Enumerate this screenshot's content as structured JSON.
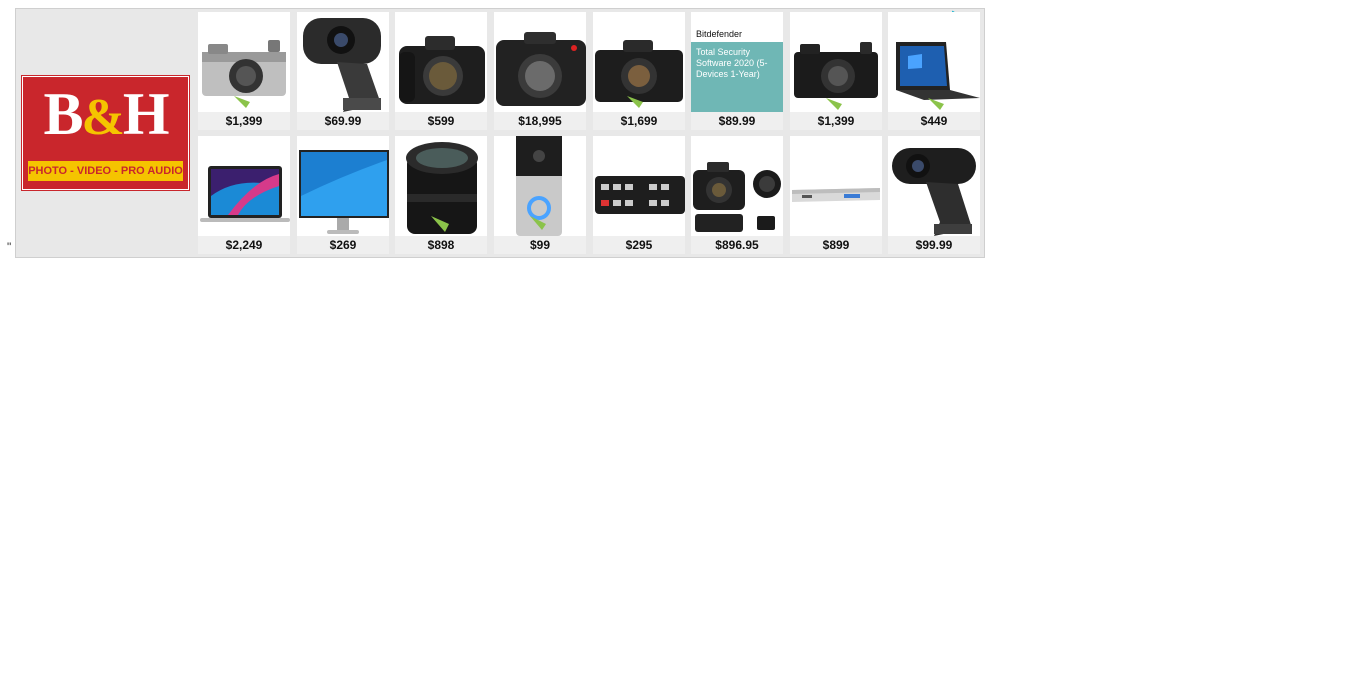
{
  "stray_text": "\"",
  "ad": {
    "brand": {
      "mark_left": "B",
      "mark_amp": "&",
      "mark_right": "H",
      "tagline": "PHOTO - VIDEO - PRO AUDIO"
    },
    "controls": {
      "adchoices_icon": "adchoices-icon",
      "close_icon": "close-icon"
    },
    "products": [
      {
        "name": "compact-camera",
        "price": "$1,399"
      },
      {
        "name": "webcam",
        "price": "$69.99"
      },
      {
        "name": "dslr-body",
        "price": "$599"
      },
      {
        "name": "leica-body",
        "price": "$18,995"
      },
      {
        "name": "mirrorless-body",
        "price": "$1,699"
      },
      {
        "name": "security-software",
        "price": "$89.99",
        "brand": "Bitdefender",
        "title": "Total Security Software 2020 (5-Devices 1-Year)"
      },
      {
        "name": "compact-camera-black",
        "price": "$1,399"
      },
      {
        "name": "laptop",
        "price": "$449"
      },
      {
        "name": "macbook",
        "price": "$2,249"
      },
      {
        "name": "monitor",
        "price": "$269"
      },
      {
        "name": "lens",
        "price": "$898"
      },
      {
        "name": "video-doorbell",
        "price": "$99"
      },
      {
        "name": "video-switcher",
        "price": "$295"
      },
      {
        "name": "dslr-kit",
        "price": "$896.95"
      },
      {
        "name": "rack-unit",
        "price": "$899"
      },
      {
        "name": "webcam-hd",
        "price": "$99.99"
      }
    ]
  },
  "colors": {
    "brand_red": "#c9262c",
    "brand_yellow": "#f5c400",
    "software_teal": "#6fb7b5",
    "adchoices_blue": "#00aecd"
  }
}
